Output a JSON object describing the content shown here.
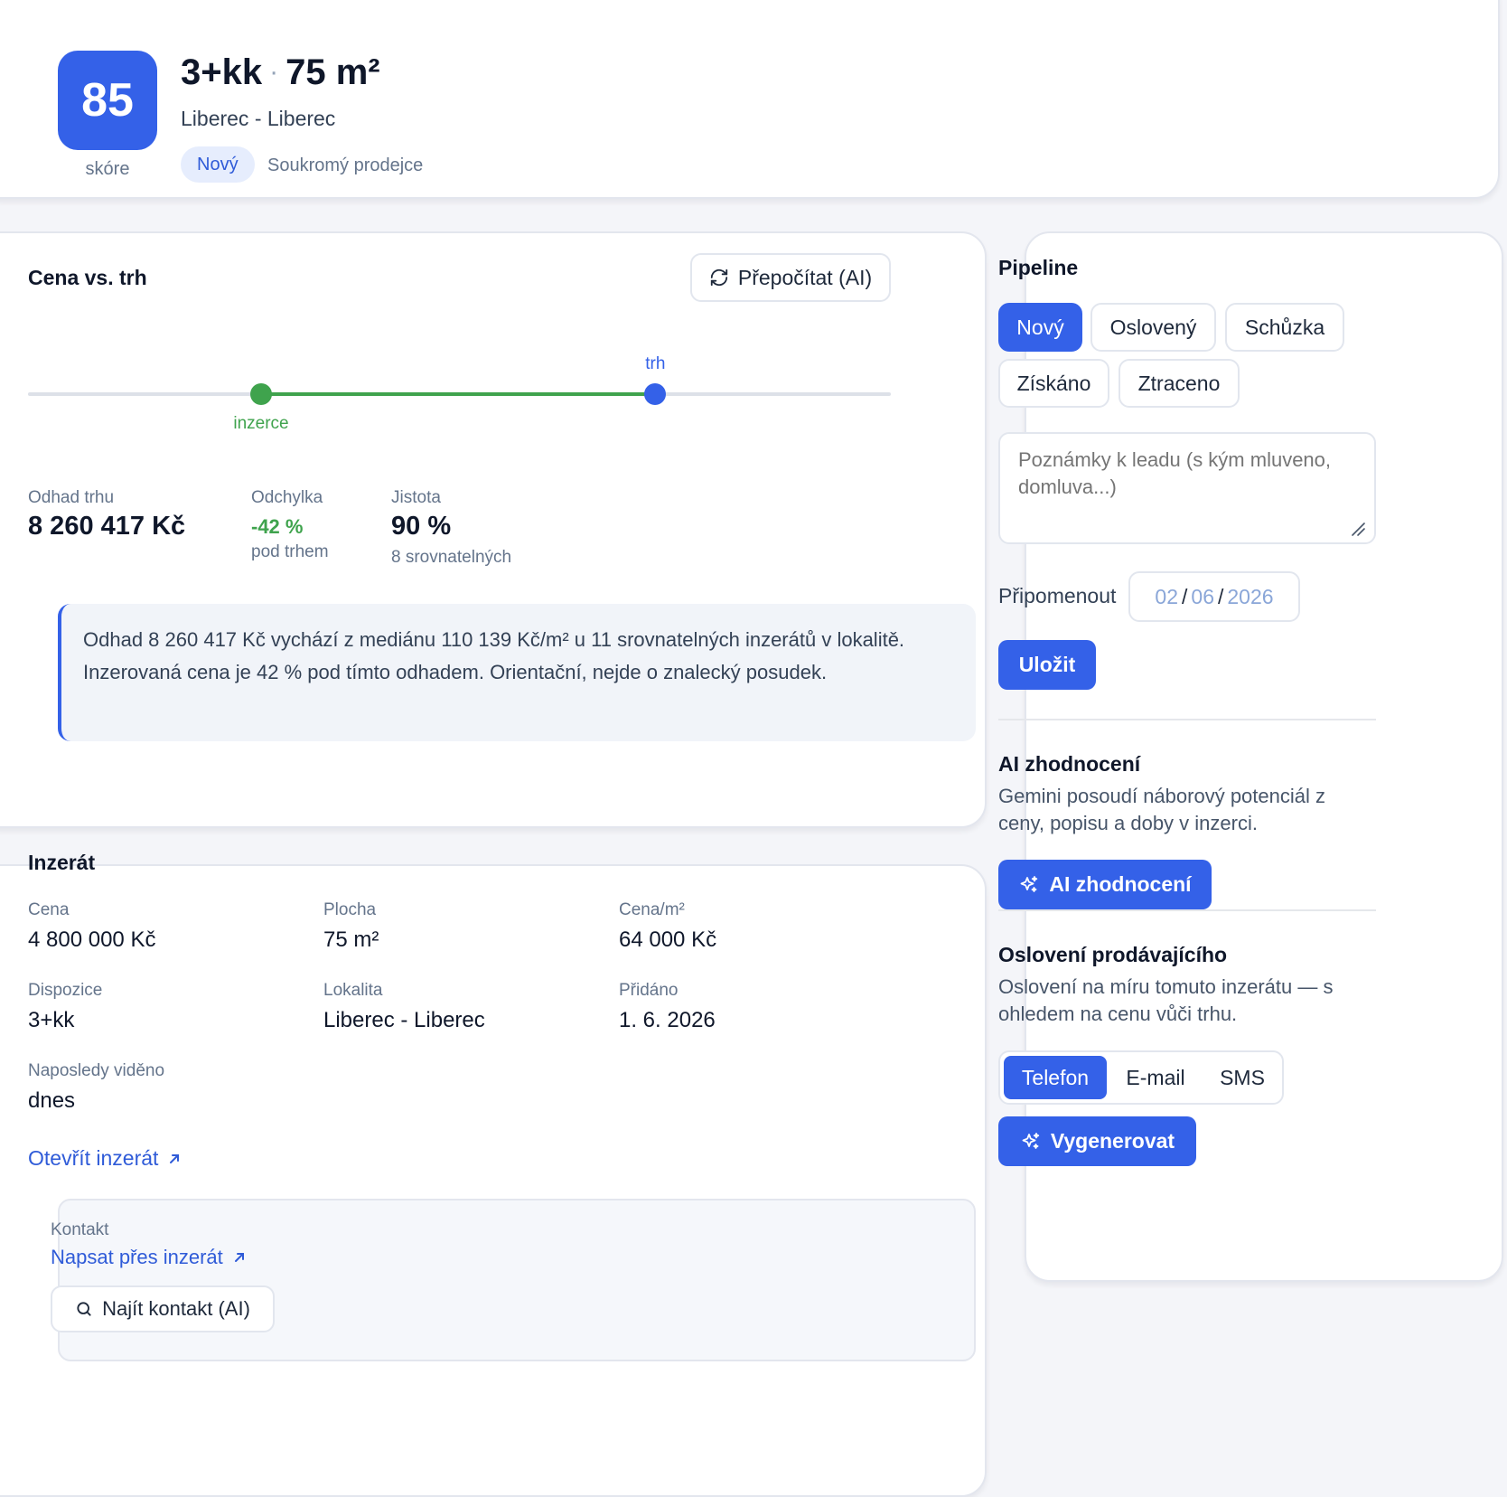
{
  "header": {
    "score": "85",
    "score_label": "skóre",
    "title_layout": "3+kk",
    "title_sep": "·",
    "title_area": "75 m²",
    "location": "Liberec - Liberec",
    "status_badge": "Nový",
    "seller_type": "Soukromý prodejce"
  },
  "price_vs_market": {
    "title": "Cena vs. trh",
    "recalc_button": "Přepočítat (AI)",
    "listing_marker_label": "inzerce",
    "market_marker_label": "trh",
    "listing_position_fraction": 0.27,
    "market_position_fraction": 0.727,
    "stats": {
      "estimate_label": "Odhad trhu",
      "estimate_value": "8 260 417 Kč",
      "deviation_label": "Odchylka",
      "deviation_value": "-42 %",
      "deviation_sub": "pod trhem",
      "confidence_label": "Jistota",
      "confidence_value": "90 %",
      "confidence_sub": "8 srovnatelných"
    },
    "explanation": "Odhad 8 260 417 Kč vychází z mediánu 110 139 Kč/m² u 11 srovnatelných inzerátů v lokalitě. Inzerovaná cena je 42 % pod tímto odhadem. Orientační, nejde o znalecký posudek."
  },
  "listing": {
    "title": "Inzerát",
    "fields": [
      {
        "label": "Cena",
        "value": "4 800 000 Kč"
      },
      {
        "label": "Plocha",
        "value": "75 m²"
      },
      {
        "label": "Cena/m²",
        "value": "64 000 Kč"
      },
      {
        "label": "Dispozice",
        "value": "3+kk"
      },
      {
        "label": "Lokalita",
        "value": "Liberec - Liberec"
      },
      {
        "label": "Přidáno",
        "value": "1. 6. 2026"
      },
      {
        "label": "Naposledy viděno",
        "value": "dnes"
      }
    ],
    "open_link": "Otevřít inzerát",
    "contact": {
      "label": "Kontakt",
      "message_link": "Napsat přes inzerát",
      "find_button": "Najít kontakt (AI)"
    }
  },
  "pipeline": {
    "title": "Pipeline",
    "stages": [
      "Nový",
      "Oslovený",
      "Schůzka",
      "Získáno",
      "Ztraceno"
    ],
    "active_stage": "Nový",
    "notes_placeholder": "Poznámky k leadu (s kým mluveno, domluva...)",
    "remind_label": "Připomenout",
    "date": {
      "day": "02",
      "month": "06",
      "year": "2026",
      "sep": "/"
    },
    "save_button": "Uložit"
  },
  "ai_evaluation": {
    "title": "AI zhodnocení",
    "description": "Gemini posoudí náborový potenciál z ceny, popisu a doby v inzerci.",
    "button": "AI zhodnocení"
  },
  "outreach": {
    "title": "Oslovení prodávajícího",
    "description": "Oslovení na míru tomuto inzerátu — s ohledem na cenu vůči trhu.",
    "channels": [
      "Telefon",
      "E-mail",
      "SMS"
    ],
    "active_channel": "Telefon",
    "generate_button": "Vygenerovat"
  },
  "colors": {
    "accent": "#3461e8",
    "positive": "#3fa34d",
    "muted_text": "#64748b"
  }
}
